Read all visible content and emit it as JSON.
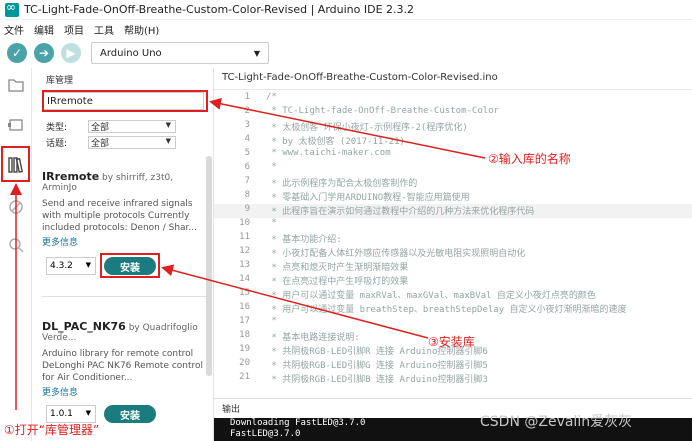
{
  "window": {
    "title": "TC-Light-Fade-OnOff-Breathe-Custom-Color-Revised | Arduino IDE 2.3.2"
  },
  "menu": [
    "文件",
    "编辑",
    "项目",
    "工具",
    "帮助(H)"
  ],
  "toolbar": {
    "board": "Arduino Uno",
    "verify_icon": "check-icon",
    "upload_icon": "arrow-right-icon",
    "debug_icon": "debug-icon"
  },
  "library_manager": {
    "header": "库管理",
    "search_value": "IRremote",
    "type_label": "类型:",
    "type_value": "全部",
    "topic_label": "话题:",
    "topic_value": "全部",
    "results": [
      {
        "name": "IRremote",
        "author": " by shirriff, z3t0, ArminJo",
        "description": "Send and receive infrared signals with multiple protocols Currently included protocols: Denon / Shar...",
        "more": "更多信息",
        "version": "4.3.2",
        "install": "安装"
      },
      {
        "name": "DL_PAC_NK76",
        "author": " by Quadrifoglio Verde...",
        "description": "Arduino library for remote control DeLonghi PAC NK76 Remote control for Air Conditioner...",
        "more": "更多信息",
        "version": "1.0.1",
        "install": "安装"
      }
    ]
  },
  "editor": {
    "tab": "TC-Light-Fade-OnOff-Breathe-Custom-Color-Revised.ino",
    "lines": [
      {
        "n": "1",
        "t": "/*"
      },
      {
        "n": "2",
        "t": " * TC-Light-fade-OnOff-Breathe-Custom-Color"
      },
      {
        "n": "3",
        "t": " * 太极创客 环保小夜灯-示例程序-2(程序优化)"
      },
      {
        "n": "4",
        "t": " * by 太极创客 (2017-11-21)"
      },
      {
        "n": "5",
        "t": " * www.taichi-maker.com"
      },
      {
        "n": "6",
        "t": " *"
      },
      {
        "n": "7",
        "t": " * 此示例程序为配合太极创客制作的"
      },
      {
        "n": "8",
        "t": " * 零基础入门学用ARDUINO教程-智能应用篇使用"
      },
      {
        "n": "9",
        "t": " * 此程序旨在演示如何通过教程中介绍的几种方法来优化程序代码"
      },
      {
        "n": "10",
        "t": " *"
      },
      {
        "n": "11",
        "t": " * 基本功能介绍:"
      },
      {
        "n": "12",
        "t": " * 小夜灯配备人体红外感应传感器以及光敏电阻实现照明自动化"
      },
      {
        "n": "13",
        "t": " * 点亮和熄灭时产生渐明渐暗效果"
      },
      {
        "n": "14",
        "t": " * 在点亮过程中产生呼吸灯的效果"
      },
      {
        "n": "15",
        "t": " * 用户可以通过变量 maxRVal、maxGVal、maxBVal 自定义小夜灯点亮的颜色"
      },
      {
        "n": "16",
        "t": " * 用户可以通过变量 breathStep、breathStepDelay 自定义小夜灯渐明渐暗的速度"
      },
      {
        "n": "17",
        "t": " *"
      },
      {
        "n": "18",
        "t": " * 基本电路连接说明:"
      },
      {
        "n": "19",
        "t": " * 共阴极RGB-LED引脚R 连接 Arduino控制器引脚6"
      },
      {
        "n": "20",
        "t": " * 共阴极RGB-LED引脚G 连接 Arduino控制器引脚5"
      },
      {
        "n": "21",
        "t": " * 共阴极RGB-LED引脚B 连接 Arduino控制器引脚3"
      }
    ]
  },
  "output": {
    "header": "输出",
    "lines": [
      "Downloading FastLED@3.7.0",
      "FastLED@3.7.0"
    ]
  },
  "watermark": "CSDN @Zevalin爱灰灰",
  "annotations": {
    "open_library": "①打开“库管理器”",
    "enter_name": "②输入库的名称",
    "install_lib": "③安装库"
  },
  "colors": {
    "accent": "#1a7c7e",
    "annotation": "#e02020"
  }
}
